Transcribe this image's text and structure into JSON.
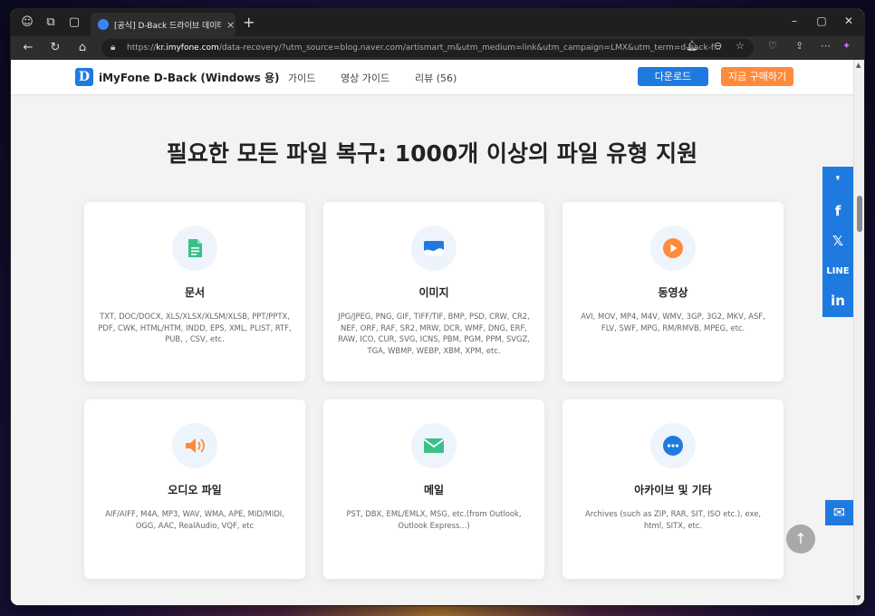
{
  "browser": {
    "tab_title": "[공식] D-Back 드라이브 데이터 복구",
    "tab_close": "×",
    "new_tab": "+",
    "url_prefix": "https://",
    "url_host": "kr.imyfone.com",
    "url_path": "/data-recovery/?utm_source=blog.naver.com/artismart_m&utm_medium=link&utm_campaign=LMX&utm_term=d-back-f..."
  },
  "site": {
    "logo_letter": "D",
    "brand": "iMyFone D-Back (Windows 용)",
    "nav": [
      "가이드",
      "영상 가이드",
      "리뷰 (56)"
    ],
    "download": "다운로드",
    "buy": "지금 구매하기"
  },
  "heading": "필요한 모든 파일 복구: 1000개 이상의 파일 유형 지원",
  "cards": [
    {
      "title": "문서",
      "desc": "TXT, DOC/DOCX, XLS/XLSX/XLSM/XLSB, PPT/PPTX, PDF, CWK, HTML/HTM, INDD, EPS, XML, PLIST, RTF, PUB, , CSV, etc.",
      "icon": "document-icon"
    },
    {
      "title": "이미지",
      "desc": "JPG/JPEG, PNG, GIF, TIFF/TIF, BMP, PSD, CRW, CR2, NEF, ORF, RAF, SR2, MRW, DCR, WMF, DNG, ERF, RAW, ICO, CUR, SVG, ICNS, PBM, PGM, PPM, SVGZ, TGA, WBMP, WEBP, XBM, XPM, etc.",
      "icon": "image-icon"
    },
    {
      "title": "동영상",
      "desc": "AVI, MOV, MP4, M4V, WMV, 3GP, 3G2, MKV, ASF, FLV, SWF, MPG, RM/RMVB, MPEG, etc.",
      "icon": "video-play-icon"
    },
    {
      "title": "오디오 파일",
      "desc": "AIF/AIFF, M4A, MP3, WAV, WMA, APE, MID/MIDI, OGG, AAC, RealAudio, VQF, etc",
      "icon": "speaker-icon"
    },
    {
      "title": "메일",
      "desc": "PST, DBX, EML/EMLX, MSG, etc.(from Outlook, Outlook Express...)",
      "icon": "mail-icon"
    },
    {
      "title": "아카이브 및 기타",
      "desc": "Archives (such as ZIP, RAR, SIT, ISO etc.), exe, html, SITX, etc.",
      "icon": "more-dots-icon"
    }
  ],
  "colors": {
    "brand_blue": "#1f7ae0",
    "buy_orange": "#ff8a3c",
    "doc_green": "#3cc08a",
    "video_orange": "#ff8a3c"
  }
}
